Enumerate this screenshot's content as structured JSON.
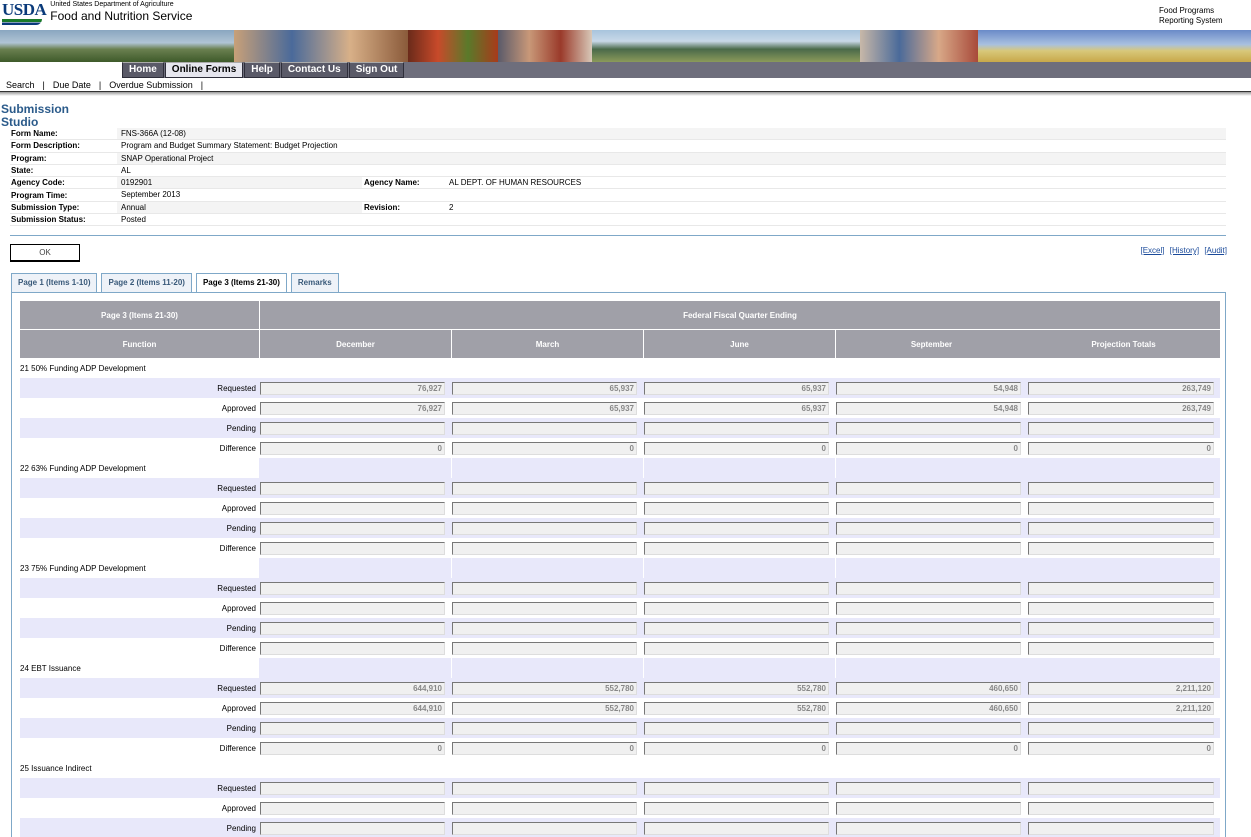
{
  "header": {
    "logo_abbr": "USDA",
    "dept": "United States Department of Agriculture",
    "agency": "Food and Nutrition Service",
    "system_line1": "Food Programs",
    "system_line2": "Reporting System"
  },
  "nav": [
    {
      "label": "Home",
      "active": false
    },
    {
      "label": "Online Forms",
      "active": true
    },
    {
      "label": "Help",
      "active": false
    },
    {
      "label": "Contact Us",
      "active": false
    },
    {
      "label": "Sign Out",
      "active": false
    }
  ],
  "subnav": [
    "Search",
    "Due Date",
    "Overdue Submission"
  ],
  "title_line1": "Submission",
  "title_line2": "Studio",
  "info": {
    "form_name_label": "Form Name:",
    "form_name": "FNS-366A (12-08)",
    "form_desc_label": "Form Description:",
    "form_desc": "Program and Budget Summary Statement: Budget Projection",
    "program_label": "Program:",
    "program": "SNAP Operational Project",
    "state_label": "State:",
    "state": "AL",
    "agency_code_label": "Agency Code:",
    "agency_code": "0192901",
    "agency_name_label": "Agency Name:",
    "agency_name": "AL DEPT. OF HUMAN RESOURCES",
    "program_time_label": "Program Time:",
    "program_time": "September 2013",
    "submission_type_label": "Submission Type:",
    "submission_type": "Annual",
    "revision_label": "Revision:",
    "revision": "2",
    "submission_status_label": "Submission Status:",
    "submission_status": "Posted"
  },
  "ok_label": "OK",
  "links": [
    "[Excel]",
    "[History]",
    "[Audit]"
  ],
  "tabs": [
    {
      "label": "Page 1 (Items 1-10)",
      "active": false
    },
    {
      "label": "Page 2 (Items 11-20)",
      "active": false
    },
    {
      "label": "Page 3 (Items 21-30)",
      "active": true
    },
    {
      "label": "Remarks",
      "active": false
    }
  ],
  "grid": {
    "corner": "Page 3 (Items 21-30)",
    "group_header": "Federal Fiscal Quarter Ending",
    "function_header": "Function",
    "columns": [
      "December",
      "March",
      "June",
      "September",
      "Projection Totals"
    ],
    "row_labels": [
      "Requested",
      "Approved",
      "Pending",
      "Difference"
    ],
    "sections": [
      {
        "title": "21 50% Funding ADP Development",
        "rows": [
          [
            "76,927",
            "65,937",
            "65,937",
            "54,948",
            "263,749"
          ],
          [
            "76,927",
            "65,937",
            "65,937",
            "54,948",
            "263,749"
          ],
          [
            "",
            "",
            "",
            "",
            ""
          ],
          [
            "0",
            "0",
            "0",
            "0",
            "0"
          ]
        ]
      },
      {
        "title": "22 63% Funding ADP Development",
        "rows": [
          [
            "",
            "",
            "",
            "",
            ""
          ],
          [
            "",
            "",
            "",
            "",
            ""
          ],
          [
            "",
            "",
            "",
            "",
            ""
          ],
          [
            "",
            "",
            "",
            "",
            ""
          ]
        ]
      },
      {
        "title": "23 75% Funding ADP Development",
        "rows": [
          [
            "",
            "",
            "",
            "",
            ""
          ],
          [
            "",
            "",
            "",
            "",
            ""
          ],
          [
            "",
            "",
            "",
            "",
            ""
          ],
          [
            "",
            "",
            "",
            "",
            ""
          ]
        ]
      },
      {
        "title": "24 EBT Issuance",
        "rows": [
          [
            "644,910",
            "552,780",
            "552,780",
            "460,650",
            "2,211,120"
          ],
          [
            "644,910",
            "552,780",
            "552,780",
            "460,650",
            "2,211,120"
          ],
          [
            "",
            "",
            "",
            "",
            ""
          ],
          [
            "0",
            "0",
            "0",
            "0",
            "0"
          ]
        ]
      },
      {
        "title": "25 Issuance Indirect",
        "rows": [
          [
            "",
            "",
            "",
            "",
            ""
          ],
          [
            "",
            "",
            "",
            "",
            ""
          ],
          [
            "",
            "",
            "",
            "",
            ""
          ]
        ]
      }
    ]
  }
}
